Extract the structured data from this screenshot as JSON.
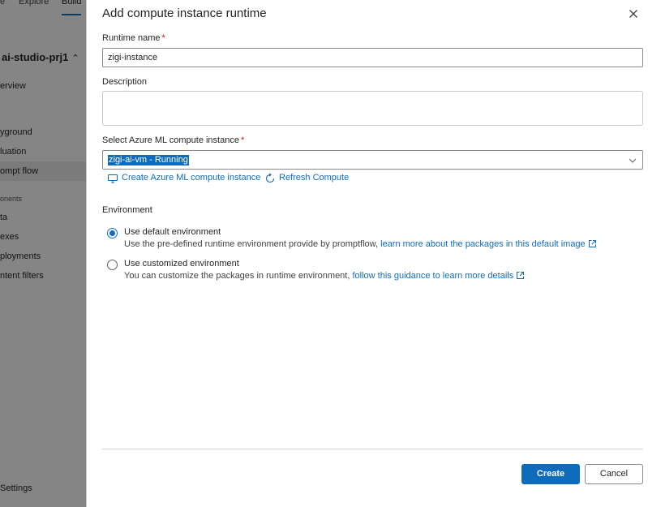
{
  "background": {
    "tabs": [
      "e",
      "Explore",
      "Build"
    ],
    "project_name": "ai-studio-prj1",
    "nav_items": [
      "erview",
      "yground",
      "luation",
      "ompt flow",
      "onents",
      "ta",
      "exes",
      "ployments",
      "ntent filters",
      "Settings"
    ]
  },
  "dialog": {
    "title": "Add compute instance runtime",
    "runtime_name_label": "Runtime name",
    "runtime_name_value": "zigi-instance",
    "description_label": "Description",
    "description_value": "",
    "compute_label": "Select Azure ML compute instance",
    "compute_selected": "zigi-ai-vm - Running",
    "create_compute_link": "Create Azure ML compute instance",
    "refresh_compute_link": "Refresh Compute",
    "environment_label": "Environment",
    "env_default_title": "Use default environment",
    "env_default_desc": "Use the pre-defined runtime environment provide by promptflow,",
    "env_default_link": "learn more about the packages in this default image",
    "env_custom_title": "Use customized environment",
    "env_custom_desc": "You can customize the packages in runtime environment,",
    "env_custom_link": "follow this guidance to learn more details",
    "selected_environment": "default",
    "create_button": "Create",
    "cancel_button": "Cancel",
    "required_mark": "*"
  },
  "colors": {
    "accent": "#0f6cbd",
    "required": "#c50f1f"
  }
}
